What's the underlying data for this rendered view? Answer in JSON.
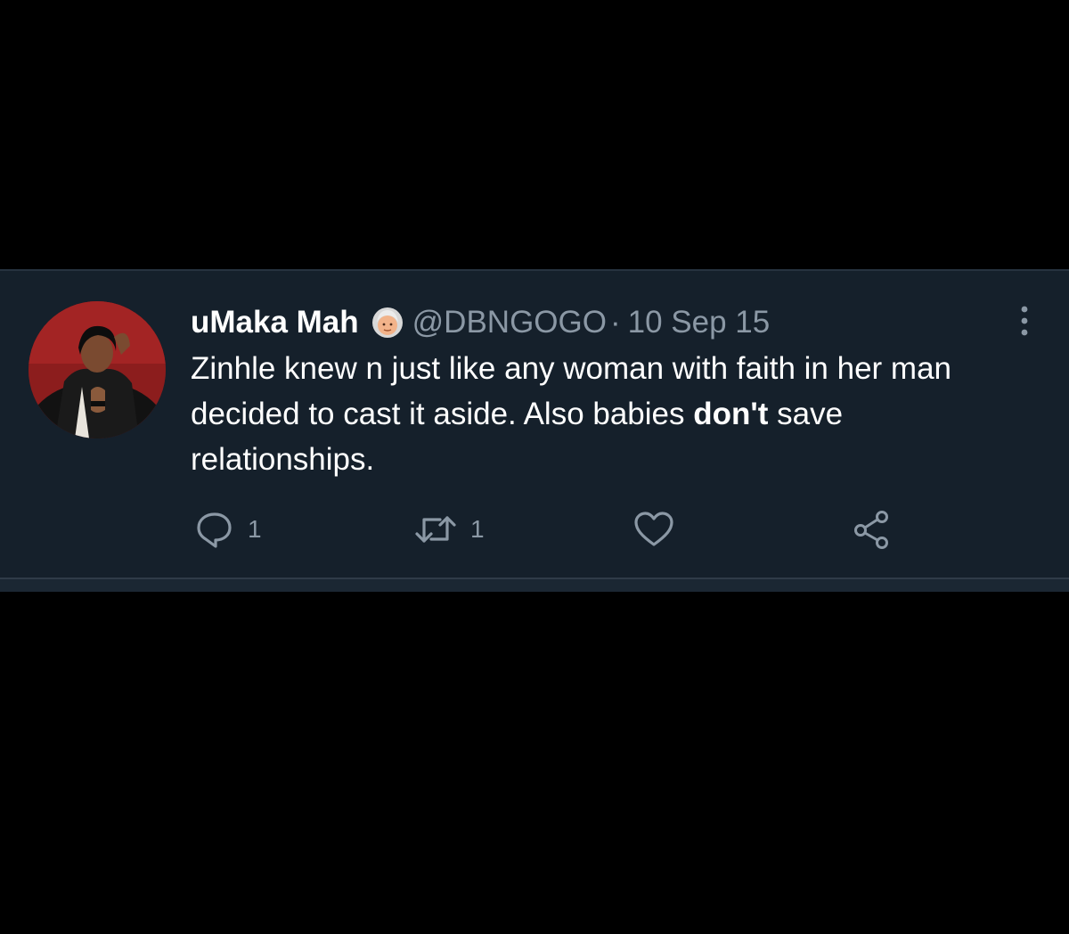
{
  "tweet": {
    "display_name": "uMaka Mah",
    "display_name_emoji": "older-woman-emoji",
    "handle": "@DBNGOGO",
    "separator": "·",
    "date": "10 Sep 15",
    "text_part1": "Zinhle knew n just like any woman with faith in her man decided to cast it aside. Also babies ",
    "text_bold": "don't",
    "text_part2": " save relationships.",
    "avatar_icon": "profile-photo",
    "more_icon": "vertical-dots-icon"
  },
  "actions": {
    "reply": {
      "icon": "reply-bubble-icon",
      "count": "1"
    },
    "retweet": {
      "icon": "retweet-icon",
      "count": "1"
    },
    "like": {
      "icon": "heart-icon",
      "count": ""
    },
    "share": {
      "icon": "share-icon",
      "count": ""
    }
  },
  "colors": {
    "background": "#000000",
    "tweet_background": "#15202b",
    "primary_text": "#ffffff",
    "secondary_text": "#8b98a5"
  }
}
